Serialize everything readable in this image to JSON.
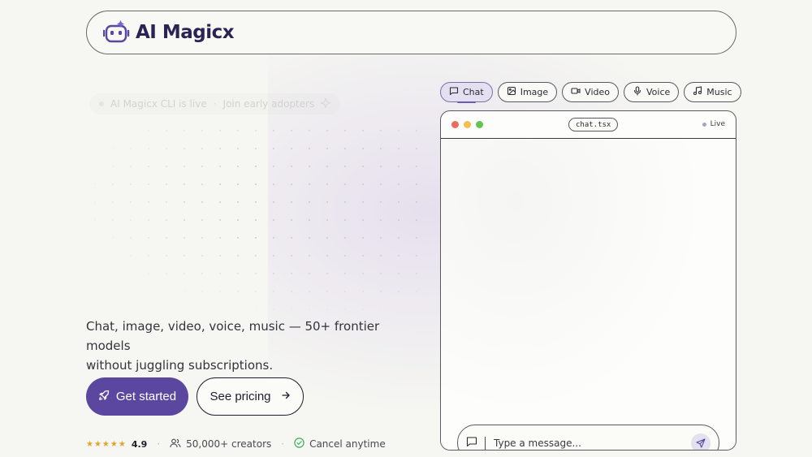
{
  "brand": {
    "name": "AI Magicx"
  },
  "announcement": {
    "text": "AI Magicx CLI is live",
    "cta": "Join early adopters"
  },
  "hero": {
    "tagline_line1": "Chat, image, video, voice, music — 50+ frontier models",
    "tagline_line2": "without juggling subscriptions.",
    "primary_cta": "Get started",
    "secondary_cta": "See pricing"
  },
  "social_proof": {
    "stars": "★★★★★",
    "rating": "4.9",
    "creators": "50,000+ creators",
    "cancel": "Cancel anytime"
  },
  "tabs": [
    {
      "label": "Chat",
      "icon": "message-square-icon",
      "active": true
    },
    {
      "label": "Image",
      "icon": "image-icon",
      "active": false
    },
    {
      "label": "Video",
      "icon": "video-icon",
      "active": false
    },
    {
      "label": "Voice",
      "icon": "microphone-icon",
      "active": false
    },
    {
      "label": "Music",
      "icon": "music-note-icon",
      "active": false
    }
  ],
  "window": {
    "filename": "chat.tsx",
    "status": "Live",
    "input_placeholder": "Type a message..."
  },
  "colors": {
    "accent": "#5b46a0",
    "brand_text": "#2a2354",
    "star": "#e3a324",
    "check": "#3fae5a",
    "traffic_red": "#ee6a5f",
    "traffic_yellow": "#f5be4f",
    "traffic_green": "#61c554"
  }
}
